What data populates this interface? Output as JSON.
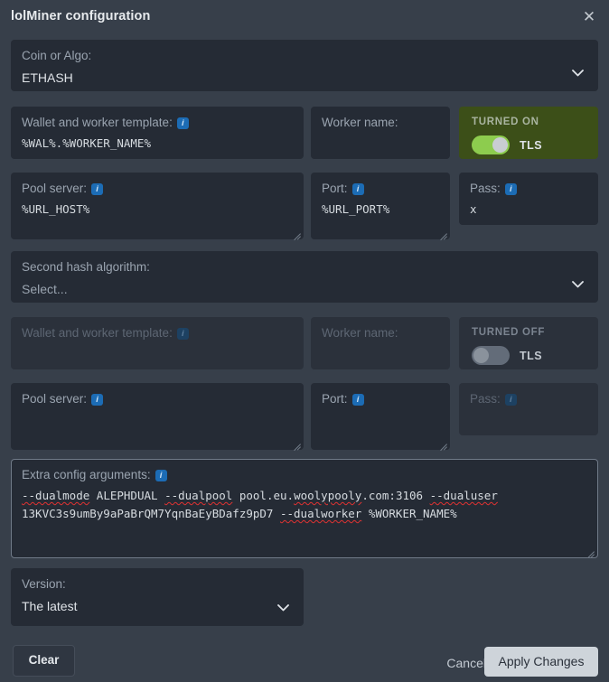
{
  "window": {
    "title": "lolMiner configuration",
    "close_icon": "close-icon"
  },
  "coin": {
    "label": "Coin or Algo:",
    "value": "ETHASH",
    "chevron_icon": "chevron-down-icon"
  },
  "primary": {
    "wallet": {
      "label": "Wallet and worker template:",
      "value": "%WAL%.%WORKER_NAME%",
      "info_icon": "info-icon"
    },
    "worker": {
      "label": "Worker name:",
      "value": ""
    },
    "tls": {
      "state": "TURNED ON",
      "label": "TLS",
      "on": true
    },
    "pool": {
      "label": "Pool server:",
      "value": "%URL_HOST%",
      "info_icon": "info-icon"
    },
    "port": {
      "label": "Port:",
      "value": "%URL_PORT%",
      "info_icon": "info-icon"
    },
    "pass": {
      "label": "Pass:",
      "value": "x",
      "info_icon": "info-icon"
    }
  },
  "second_algo": {
    "label": "Second hash algorithm:",
    "value": "Select...",
    "chevron_icon": "chevron-down-icon"
  },
  "secondary": {
    "wallet": {
      "label": "Wallet and worker template:",
      "value": "",
      "info_icon": "info-icon"
    },
    "worker": {
      "label": "Worker name:",
      "value": ""
    },
    "tls": {
      "state": "TURNED OFF",
      "label": "TLS",
      "on": false
    },
    "pool": {
      "label": "Pool server:",
      "value": "",
      "info_icon": "info-icon"
    },
    "port": {
      "label": "Port:",
      "value": "",
      "info_icon": "info-icon"
    },
    "pass": {
      "label": "Pass:",
      "value": "",
      "info_icon": "info-icon"
    }
  },
  "extra_config": {
    "label": "Extra config arguments:",
    "info_icon": "info-icon",
    "tokens": [
      {
        "text": "--dualmode",
        "spellcheck_error": true
      },
      {
        "text": " ALEPHDUAL ",
        "spellcheck_error": false
      },
      {
        "text": "--dualpool",
        "spellcheck_error": true
      },
      {
        "text": " pool.eu.",
        "spellcheck_error": false
      },
      {
        "text": "woolypooly",
        "spellcheck_error": true
      },
      {
        "text": ".com:3106 ",
        "spellcheck_error": false
      },
      {
        "text": "--dualuser",
        "spellcheck_error": true
      },
      {
        "text": "\n13KVC3s9umBy9aPaBrQM7YqnBaEyBDafz9pD7 ",
        "spellcheck_error": false
      },
      {
        "text": "--dualworker",
        "spellcheck_error": true
      },
      {
        "text": " %WORKER_NAME%",
        "spellcheck_error": false
      }
    ]
  },
  "version": {
    "label": "Version:",
    "value": "The latest",
    "chevron_icon": "chevron-down-icon"
  },
  "footer": {
    "clear": "Clear",
    "cancel": "Cancel",
    "apply": "Apply Changes"
  },
  "colors": {
    "dialog_bg": "#373f4a",
    "field_bg": "#252b35",
    "disabled_field_bg": "#2b313b",
    "tls_on_bg": "#3c4f18",
    "toggle_on": "#8dcc4e",
    "info_badge": "#1c6cb5",
    "apply_bg": "#ced4da",
    "spellcheck_underline": "#e03232"
  }
}
